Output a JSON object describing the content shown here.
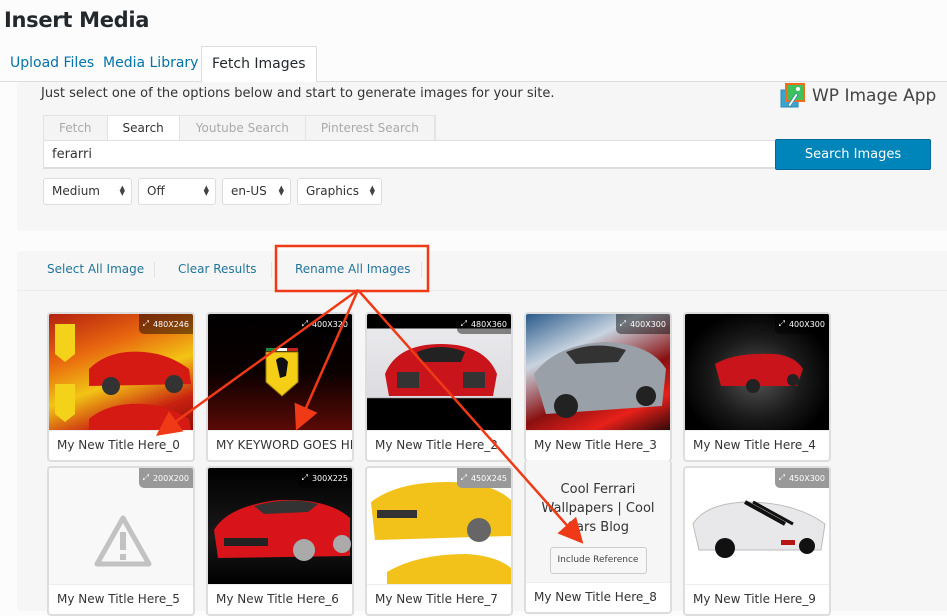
{
  "modal": {
    "title": "Insert Media",
    "router_tabs": [
      {
        "label": "Upload Files",
        "active": false
      },
      {
        "label": "Media Library",
        "active": false
      },
      {
        "label": "Fetch Images",
        "active": true
      }
    ]
  },
  "fetch_panel": {
    "intro": "Just select one of the options below and start to generate images for your site.",
    "logo_text": "WP Image App",
    "search_tabs": [
      {
        "label": "Fetch",
        "active": false
      },
      {
        "label": "Search",
        "active": true
      },
      {
        "label": "Youtube Search",
        "active": false
      },
      {
        "label": "Pinterest Search",
        "active": false
      }
    ],
    "search_value": "ferarri",
    "search_button": "Search Images",
    "filters": {
      "size": "Medium",
      "safe_search": "Off",
      "language": "en-US",
      "type": "Graphics"
    }
  },
  "results": {
    "actions": {
      "select_all": "Select All Image",
      "clear": "Clear Results",
      "rename_all": "Rename All Images"
    },
    "images": [
      {
        "title": "My New Title Here_0",
        "dimensions": "480X246",
        "description": "red Ferrari convertible with Ferrari logo banner"
      },
      {
        "title": "MY KEYWORD GOES HE",
        "dimensions": "400X320",
        "description": "Ferrari prancing horse logo on dark red"
      },
      {
        "title": "My New Title Here_2",
        "dimensions": "480X360",
        "description": "red Ferrari F80 concept front view"
      },
      {
        "title": "My New Title Here_3",
        "dimensions": "400X300",
        "description": "silver Ferrari with red light streaks"
      },
      {
        "title": "My New Title Here_4",
        "dimensions": "400X300",
        "description": "red Ferrari California on dark background"
      },
      {
        "title": "My New Title Here_5",
        "dimensions": "200X200",
        "description": "broken image warning placeholder"
      },
      {
        "title": "My New Title Here_6",
        "dimensions": "300X225",
        "description": "red Ferrari California front view"
      },
      {
        "title": "My New Title Here_7",
        "dimensions": "450X245",
        "description": "yellow Ferrari 458 Spider"
      },
      {
        "title": "My New Title Here_8",
        "dimensions": "",
        "reference_text": "Cool Ferrari Wallpapers | Cool Cars Blog",
        "reference_button": "Include Reference"
      },
      {
        "title": "My New Title Here_9",
        "dimensions": "450X300",
        "description": "white Ferrari F430 with black stripes"
      }
    ]
  },
  "colors": {
    "primary_button": "#0085ba",
    "link": "#0073aa",
    "annotation": "#f03a17"
  }
}
